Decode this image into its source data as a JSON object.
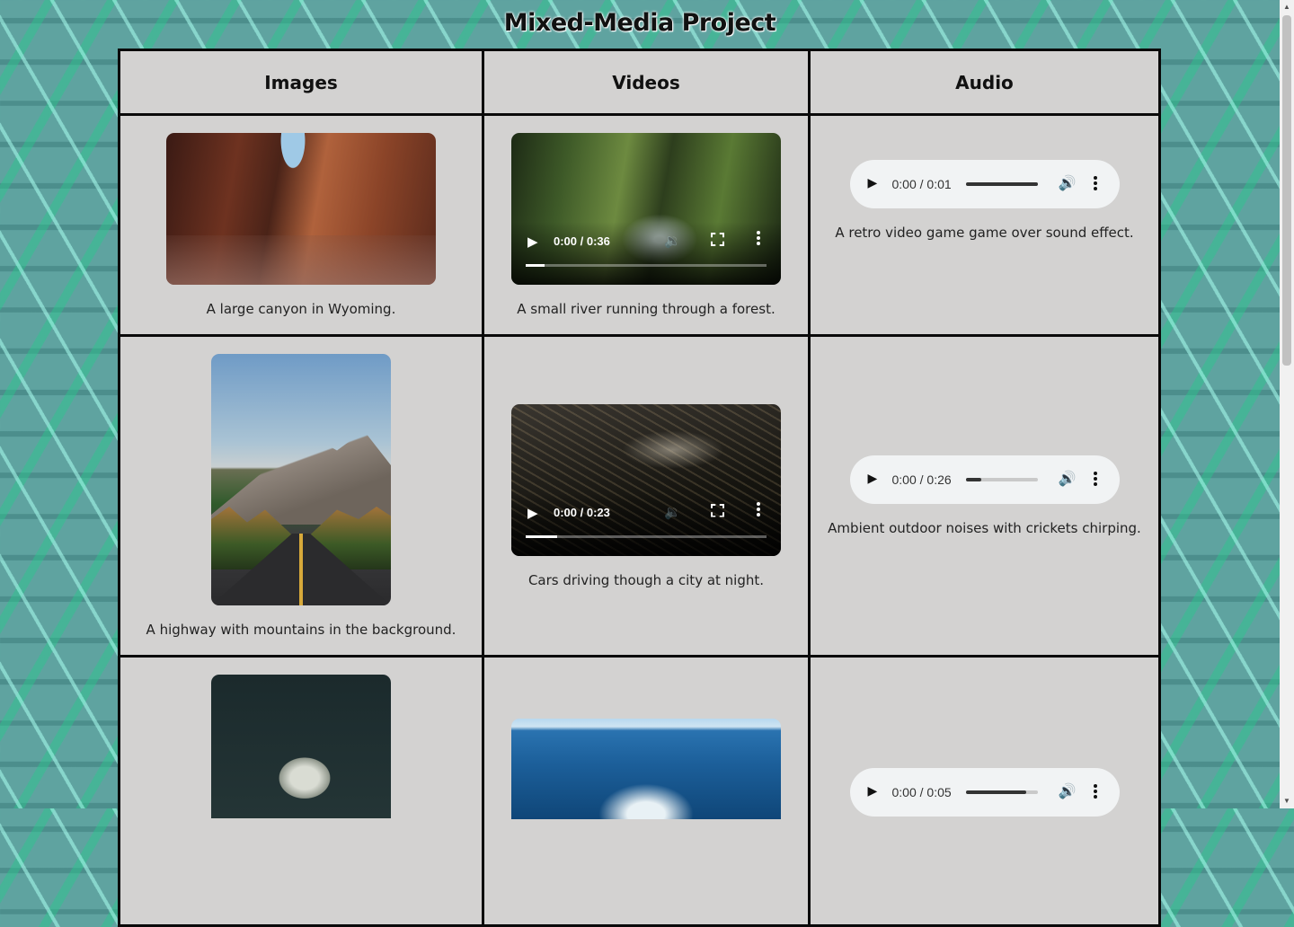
{
  "page": {
    "title": "Mixed-Media Project"
  },
  "table": {
    "headers": [
      "Images",
      "Videos",
      "Audio"
    ],
    "rows": [
      {
        "image_caption": "A large canyon in Wyoming.",
        "video": {
          "time": "0:00 / 0:36",
          "caption": "A small river running through a forest.",
          "progress": 0.08
        },
        "audio": {
          "time": "0:00 / 0:01",
          "caption": "A retro video game game over sound effect.",
          "level": 1.0
        }
      },
      {
        "image_caption": "A highway with mountains in the background.",
        "video": {
          "time": "0:00 / 0:23",
          "caption": "Cars driving though a city at night.",
          "progress": 0.13
        },
        "audio": {
          "time": "0:00 / 0:26",
          "caption": "Ambient outdoor noises with crickets chirping.",
          "level": 0.22
        }
      },
      {
        "audio": {
          "time": "0:00 / 0:05",
          "level": 0.84
        }
      }
    ]
  },
  "icons": {
    "play": "play-icon",
    "volume": "volume-icon",
    "fullscreen": "fullscreen-icon",
    "more": "more-options-icon"
  },
  "colors": {
    "table_bg": "#d3d2d1",
    "border": "#0a0a0a",
    "audio_pill": "#f1f3f4"
  }
}
